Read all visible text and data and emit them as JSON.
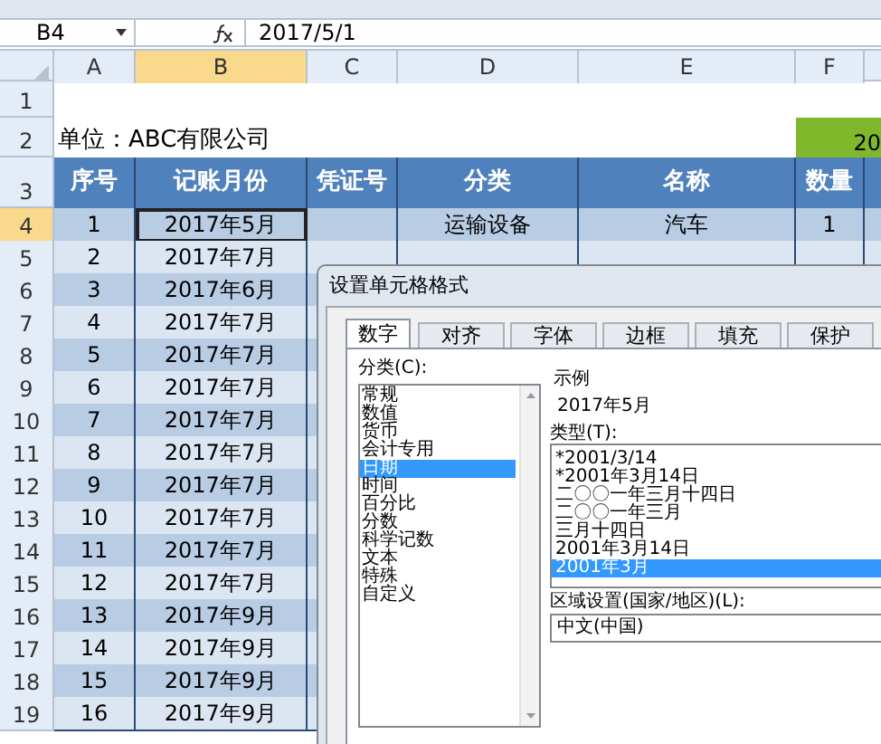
{
  "formula_bar": {
    "name_box": "B4",
    "formula": "2017/5/1"
  },
  "columns": [
    {
      "label": "A",
      "selected": false
    },
    {
      "label": "B",
      "selected": true
    },
    {
      "label": "C",
      "selected": false
    },
    {
      "label": "D",
      "selected": false
    },
    {
      "label": "E",
      "selected": false
    },
    {
      "label": "F",
      "selected": false
    }
  ],
  "row_numbers": [
    {
      "label": "1",
      "selected": false
    },
    {
      "label": "2",
      "selected": false
    },
    {
      "label": "3",
      "selected": false
    },
    {
      "label": "4",
      "selected": true
    },
    {
      "label": "5",
      "selected": false
    },
    {
      "label": "6",
      "selected": false
    },
    {
      "label": "7",
      "selected": false
    },
    {
      "label": "8",
      "selected": false
    },
    {
      "label": "9",
      "selected": false
    },
    {
      "label": "10",
      "selected": false
    },
    {
      "label": "11",
      "selected": false
    },
    {
      "label": "12",
      "selected": false
    },
    {
      "label": "13",
      "selected": false
    },
    {
      "label": "14",
      "selected": false
    },
    {
      "label": "15",
      "selected": false
    },
    {
      "label": "16",
      "selected": false
    },
    {
      "label": "17",
      "selected": false
    },
    {
      "label": "18",
      "selected": false
    },
    {
      "label": "19",
      "selected": false
    }
  ],
  "unit_label": "单位：ABC有限公司",
  "banner": "20",
  "headers": [
    "序号",
    "记账月份",
    "凭证号",
    "分类",
    "名称",
    "数量"
  ],
  "records": [
    {
      "seq": "1",
      "month": "2017年5月",
      "category": "运输设备",
      "name": "汽车",
      "qty": "1",
      "selected": true
    },
    {
      "seq": "2",
      "month": "2017年7月",
      "selected": false
    },
    {
      "seq": "3",
      "month": "2017年6月",
      "selected": false
    },
    {
      "seq": "4",
      "month": "2017年7月",
      "selected": false
    },
    {
      "seq": "5",
      "month": "2017年7月",
      "selected": false
    },
    {
      "seq": "6",
      "month": "2017年7月",
      "selected": false
    },
    {
      "seq": "7",
      "month": "2017年7月",
      "selected": false
    },
    {
      "seq": "8",
      "month": "2017年7月",
      "selected": false
    },
    {
      "seq": "9",
      "month": "2017年7月",
      "selected": false
    },
    {
      "seq": "10",
      "month": "2017年7月",
      "selected": false
    },
    {
      "seq": "11",
      "month": "2017年7月",
      "selected": false
    },
    {
      "seq": "12",
      "month": "2017年7月",
      "selected": false
    },
    {
      "seq": "13",
      "month": "2017年9月",
      "selected": false
    },
    {
      "seq": "14",
      "month": "2017年9月",
      "selected": false
    },
    {
      "seq": "15",
      "month": "2017年9月",
      "selected": false
    },
    {
      "seq": "16",
      "month": "2017年9月",
      "selected": false
    }
  ],
  "dialog": {
    "title": "设置单元格格式",
    "tabs": [
      {
        "label": "数字",
        "selected": true
      },
      {
        "label": "对齐",
        "selected": false
      },
      {
        "label": "字体",
        "selected": false
      },
      {
        "label": "边框",
        "selected": false
      },
      {
        "label": "填充",
        "selected": false
      },
      {
        "label": "保护",
        "selected": false
      }
    ],
    "category_label": "分类(C):",
    "categories": [
      {
        "label": "常规",
        "selected": false
      },
      {
        "label": "数值",
        "selected": false
      },
      {
        "label": "货币",
        "selected": false
      },
      {
        "label": "会计专用",
        "selected": false
      },
      {
        "label": "日期",
        "selected": true
      },
      {
        "label": "时间",
        "selected": false
      },
      {
        "label": "百分比",
        "selected": false
      },
      {
        "label": "分数",
        "selected": false
      },
      {
        "label": "科学记数",
        "selected": false
      },
      {
        "label": "文本",
        "selected": false
      },
      {
        "label": "特殊",
        "selected": false
      },
      {
        "label": "自定义",
        "selected": false
      }
    ],
    "sample_label": "示例",
    "sample": "2017年5月",
    "type_label": "类型(T):",
    "types": [
      {
        "label": "*2001/3/14",
        "selected": false
      },
      {
        "label": "*2001年3月14日",
        "selected": false
      },
      {
        "label": "二〇〇一年三月十四日",
        "selected": false
      },
      {
        "label": "二〇〇一年三月",
        "selected": false
      },
      {
        "label": "三月十四日",
        "selected": false
      },
      {
        "label": "2001年3月14日",
        "selected": false
      },
      {
        "label": "2001年3月",
        "selected": true
      }
    ],
    "locale_label": "区域设置(国家/地区)(L):",
    "locale": "中文(中国)"
  }
}
